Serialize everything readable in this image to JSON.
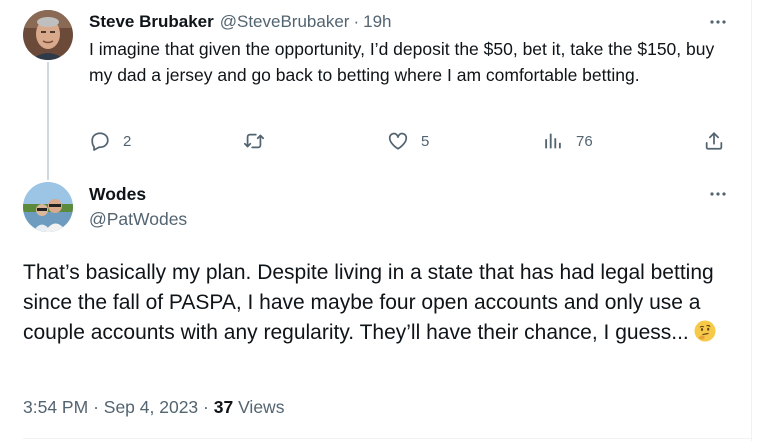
{
  "reply_tweet": {
    "author_name": "Steve Brubaker",
    "handle": "@SteveBrubaker",
    "separator": "·",
    "time_ago": "19h",
    "text": "I imagine that given the opportunity, I’d deposit the $50, bet it, take the $150, buy my dad a jersey and go back to betting where I am comfortable betting.",
    "actions": {
      "replies": "2",
      "retweets": "",
      "likes": "5",
      "views": "76"
    }
  },
  "main_tweet": {
    "author_name": "Wodes",
    "handle": "@PatWodes",
    "text": "That’s basically my plan. Despite living in a state that has had legal betting since the fall of PASPA, I have maybe four open accounts and only use a couple accounts with any regularity. They’ll have their chance, I guess...",
    "emoji": "thinking-face",
    "time": "3:54 PM",
    "separator": "·",
    "date": "Sep 4, 2023",
    "views_count": "37",
    "views_label": "Views"
  },
  "colors": {
    "text": "#0f1419",
    "muted": "#536471",
    "thread_line": "#cfd9de",
    "divider": "#eff3f4"
  },
  "icons": [
    "more-icon",
    "reply-icon",
    "retweet-icon",
    "like-icon",
    "analytics-icon",
    "share-icon",
    "thinking-face-emoji"
  ]
}
